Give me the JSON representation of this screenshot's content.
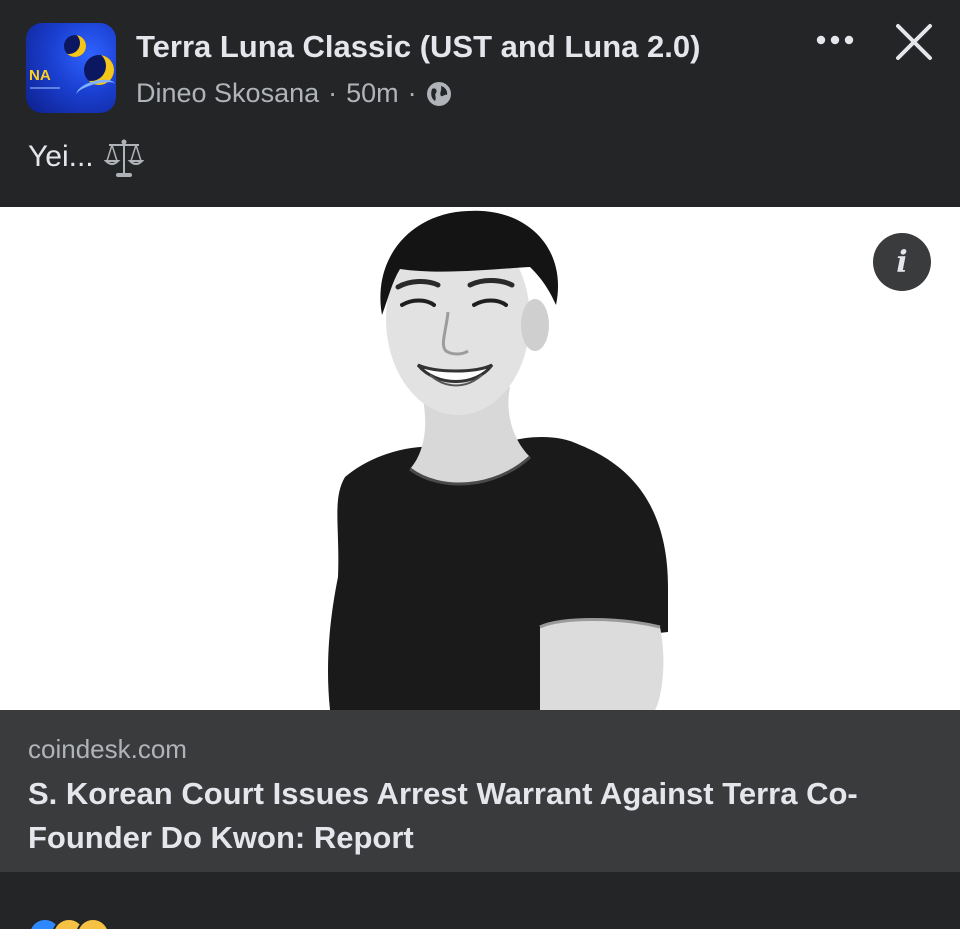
{
  "post": {
    "group_name": "Terra Luna Classic (UST and Luna 2.0)",
    "avatar_text": "NA",
    "author": "Dineo Skosana",
    "separator": "·",
    "time": "50m",
    "text": "Yei...",
    "icons": {
      "more": "more-horizontal-icon",
      "close": "close-icon",
      "audience": "globe-icon",
      "emoji": "balance-scale-icon",
      "info": "info-icon"
    }
  },
  "link_preview": {
    "image_subject": "black-and-white portrait photo",
    "info_glyph": "i",
    "domain": "coindesk.com",
    "title": "S. Korean Court Issues Arrest Warrant Against Terra Co-Founder Do Kwon: Report"
  },
  "reactions": [
    "like",
    "haha",
    "wow"
  ],
  "colors": {
    "background": "#242526",
    "caption_background": "#3a3b3c",
    "primary_text": "#e4e6eb",
    "secondary_text": "#b0b3b8",
    "like_blue": "#2e89ff",
    "reaction_yellow": "#f7c244"
  }
}
